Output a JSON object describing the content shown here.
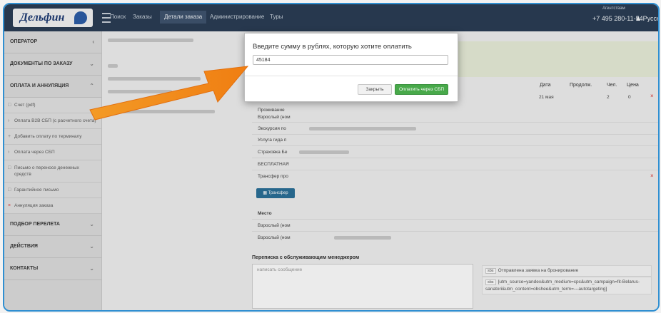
{
  "app": {
    "logo_text": "Дельфин",
    "nav": [
      {
        "label": "Поиск"
      },
      {
        "label": "Заказы"
      },
      {
        "label": "Детали заказа"
      },
      {
        "label": "Администрирование"
      },
      {
        "label": "Туры"
      }
    ],
    "phone_label": "Агентствам",
    "phone": "+7 495 280-11-54",
    "language": "Русский"
  },
  "sidebar": {
    "sections": [
      {
        "label": "ОПЕРАТОР"
      },
      {
        "label": "ДОКУМЕНТЫ ПО ЗАКАЗУ"
      },
      {
        "label": "ОПЛАТА И АННУЛЯЦИЯ"
      }
    ],
    "payment_items": [
      {
        "label": "Счет (pdf)"
      },
      {
        "label": "Оплата B2B СБП (с расчетного счета)"
      },
      {
        "label": "Добавить оплату по терминалу"
      },
      {
        "label": "Оплата через СБП"
      },
      {
        "label": "Письмо о переносе денежных средств"
      },
      {
        "label": "Гарантийное письмо"
      },
      {
        "label": "Аннуляция заказа"
      }
    ],
    "bottom_sections": [
      {
        "label": "ПОДБОР ПЕРЕЛЕТА"
      },
      {
        "label": "ДЕЙСТВИЯ"
      },
      {
        "label": "КОНТАКТЫ"
      }
    ]
  },
  "table": {
    "headers": {
      "date": "Дата",
      "duration": "Продолж.",
      "people": "Чел.",
      "price": "Цена"
    },
    "first_date": "21 мая",
    "first_people": "2",
    "first_price": "0",
    "rows": [
      {
        "label": "Проживание"
      },
      {
        "label": "Взрослый (ном"
      },
      {
        "label": "Экскурсия по"
      },
      {
        "label": "Услуга гида п"
      },
      {
        "label": "Страховка Бе"
      },
      {
        "label": "БЕСПЛАТНАЯ"
      },
      {
        "label": "Трансфер про"
      }
    ],
    "transfer_button": "Трансфер",
    "places_header": "Место",
    "places": [
      {
        "label": "Взрослый (ном"
      },
      {
        "label": "Взрослый (ном"
      }
    ]
  },
  "correspondence": {
    "title": "Переписка с обслуживающим менеджером",
    "placeholder": "написать сообщение",
    "log": [
      {
        "tag": "sbs",
        "text": "Отправлена заявка на бронирование"
      },
      {
        "tag": "sbs",
        "text": "[utm_source=yandex&utm_medium=cpc&utm_campaign=fit-Belarus-sanatori&utm_content=obshee&utm_term=---autotargeting]"
      }
    ]
  },
  "modal": {
    "title": "Введите сумму в рублях, которую хотите оплатить",
    "amount_value": "45184",
    "close_label": "Закрыть",
    "pay_label": "Оплатить через СБП"
  },
  "colors": {
    "navbar": "#2b3d54",
    "pay_button": "#48a94a",
    "arrow": "#f08a1c",
    "frame": "#2f8fd1"
  }
}
